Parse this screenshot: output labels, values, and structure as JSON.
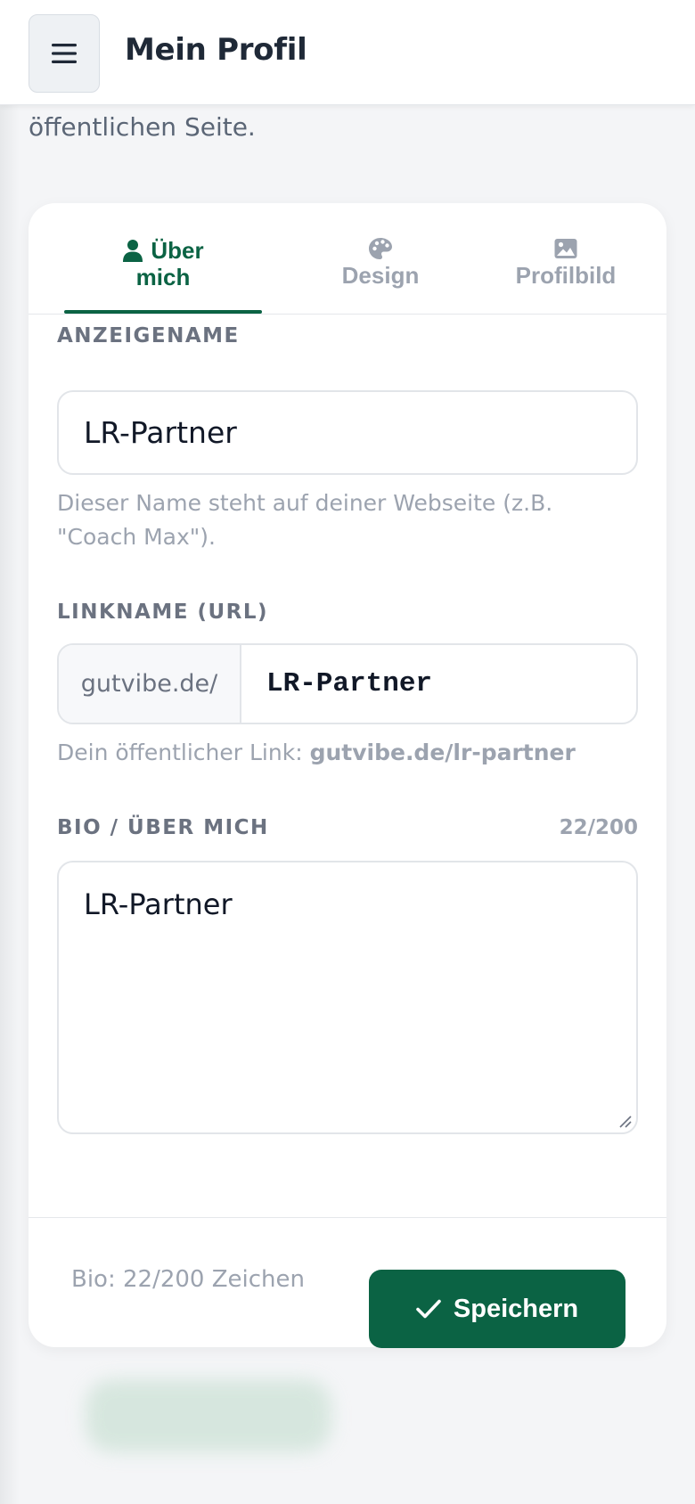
{
  "header": {
    "title": "Mein Profil",
    "menu_icon": "hamburger-menu-icon"
  },
  "intro": {
    "text": "öffentlichen Seite."
  },
  "tabs": [
    {
      "label_line1": "Über",
      "label_line2": "mich",
      "icon": "user-icon",
      "active": true
    },
    {
      "label": "Design",
      "icon": "palette-icon",
      "active": false
    },
    {
      "label": "Profilbild",
      "icon": "image-icon",
      "active": false
    }
  ],
  "form": {
    "display_name": {
      "label": "ANZEIGENAME",
      "value": "LR-Partner",
      "hint": "Dieser Name steht auf deiner Webseite (z.B. \"Coach Max\")."
    },
    "link_name": {
      "label": "LINKNAME (URL)",
      "prefix": "gutvibe.de/",
      "value": "LR-Partner",
      "hint_prefix": "Dein öffentlicher Link:",
      "hint_link": "gutvibe.de/lr-partner"
    },
    "bio": {
      "label": "BIO / ÜBER MICH",
      "counter": "22/200",
      "value": "LR-Partner"
    }
  },
  "footer": {
    "bio_count": "Bio: 22/200 Zeichen",
    "save_label": "Speichern"
  },
  "colors": {
    "accent": "#0b6344",
    "muted": "#9ca3af"
  }
}
